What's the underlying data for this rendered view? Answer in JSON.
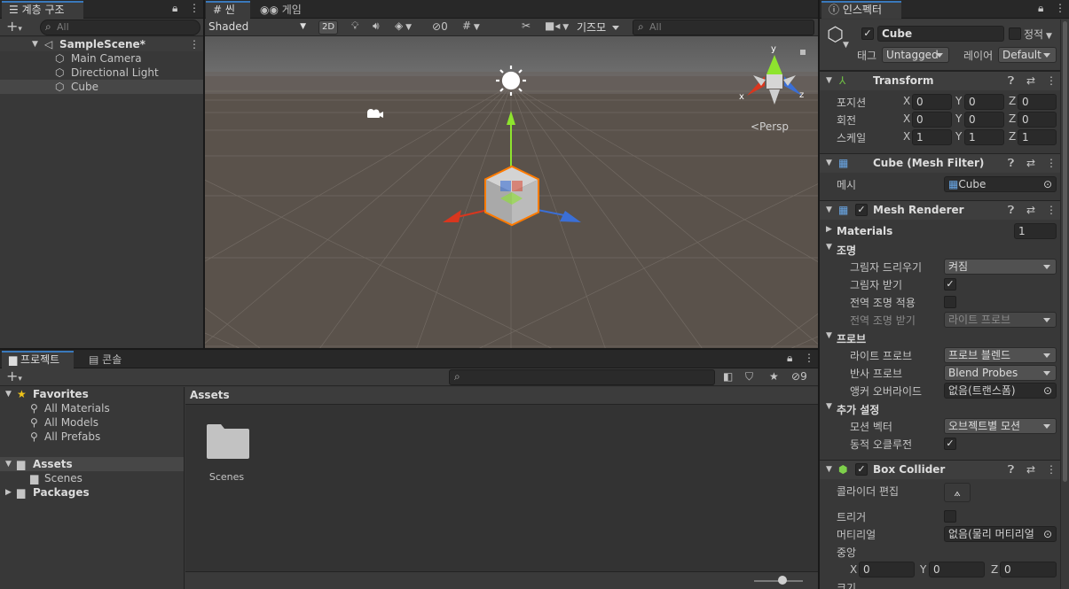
{
  "hierarchy": {
    "tab": "계층 구조",
    "search_placeholder": "All",
    "scene": "SampleScene*",
    "items": [
      "Main Camera",
      "Directional Light",
      "Cube"
    ]
  },
  "scene": {
    "tab_scene": "씬",
    "tab_game": "게임",
    "shading": "Shaded",
    "btn_2d": "2D",
    "hidden_count": "0",
    "gizmos": "기즈모",
    "search_placeholder": "All",
    "persp": "<Persp",
    "axis_y": "y",
    "axis_x": "x",
    "axis_z": "z"
  },
  "project": {
    "tab_project": "프로젝트",
    "tab_console": "콘솔",
    "favorites": "Favorites",
    "fav_items": [
      "All Materials",
      "All Models",
      "All Prefabs"
    ],
    "assets": "Assets",
    "scenes": "Scenes",
    "packages": "Packages",
    "breadcrumb": "Assets",
    "folder_label": "Scenes",
    "hidden_count": "9",
    "zoom": 0.4
  },
  "inspector": {
    "tab": "인스펙터",
    "name": "Cube",
    "static": "정적",
    "tag_label": "태그",
    "tag": "Untagged",
    "layer_label": "레이어",
    "layer": "Default",
    "transform": {
      "title": "Transform",
      "position_label": "포지션",
      "rotation_label": "회전",
      "scale_label": "스케일",
      "position": {
        "x": "0",
        "y": "0",
        "z": "0"
      },
      "rotation": {
        "x": "0",
        "y": "0",
        "z": "0"
      },
      "scale": {
        "x": "1",
        "y": "1",
        "z": "1"
      },
      "ax": "X",
      "ay": "Y",
      "az": "Z"
    },
    "mesh_filter": {
      "title": "Cube (Mesh Filter)",
      "mesh_label": "메시",
      "mesh": "Cube"
    },
    "mesh_renderer": {
      "title": "Mesh Renderer",
      "materials_label": "Materials",
      "materials_count": "1",
      "lighting": "조명",
      "cast_shadows_label": "그림자 드리우기",
      "cast_shadows": "켜짐",
      "receive_shadows_label": "그림자 받기",
      "gi_label": "전역 조명 적용",
      "receive_gi_label": "전역 조명 받기",
      "receive_gi": "라이트 프로브",
      "probes": "프로브",
      "light_probes_label": "라이트 프로브",
      "light_probes": "프로브 블렌드",
      "reflection_probes_label": "반사 프로브",
      "reflection_probes": "Blend Probes",
      "anchor_label": "앵커 오버라이드",
      "anchor": "없음(트랜스폼)",
      "additional": "추가 설정",
      "motion_label": "모션 벡터",
      "motion": "오브젝트별 모션",
      "occlusion_label": "동적 오클루전"
    },
    "box_collider": {
      "title": "Box Collider",
      "edit_label": "콜라이더 편집",
      "trigger_label": "트리거",
      "material_label": "머티리얼",
      "material": "없음(물리 머티리얼",
      "center_label": "중앙",
      "center": {
        "x": "0",
        "y": "0",
        "z": "0"
      },
      "size_label": "크기"
    }
  },
  "colors": {
    "accent": "#3a79bb",
    "selection": "#2c5d87",
    "scene_sky": "#6e6e6e",
    "scene_ground": "#59524c",
    "axis_x": "#d9361e",
    "axis_y": "#8ee42e",
    "axis_z": "#3b6fd6",
    "selected_outline": "#ff7b00"
  }
}
